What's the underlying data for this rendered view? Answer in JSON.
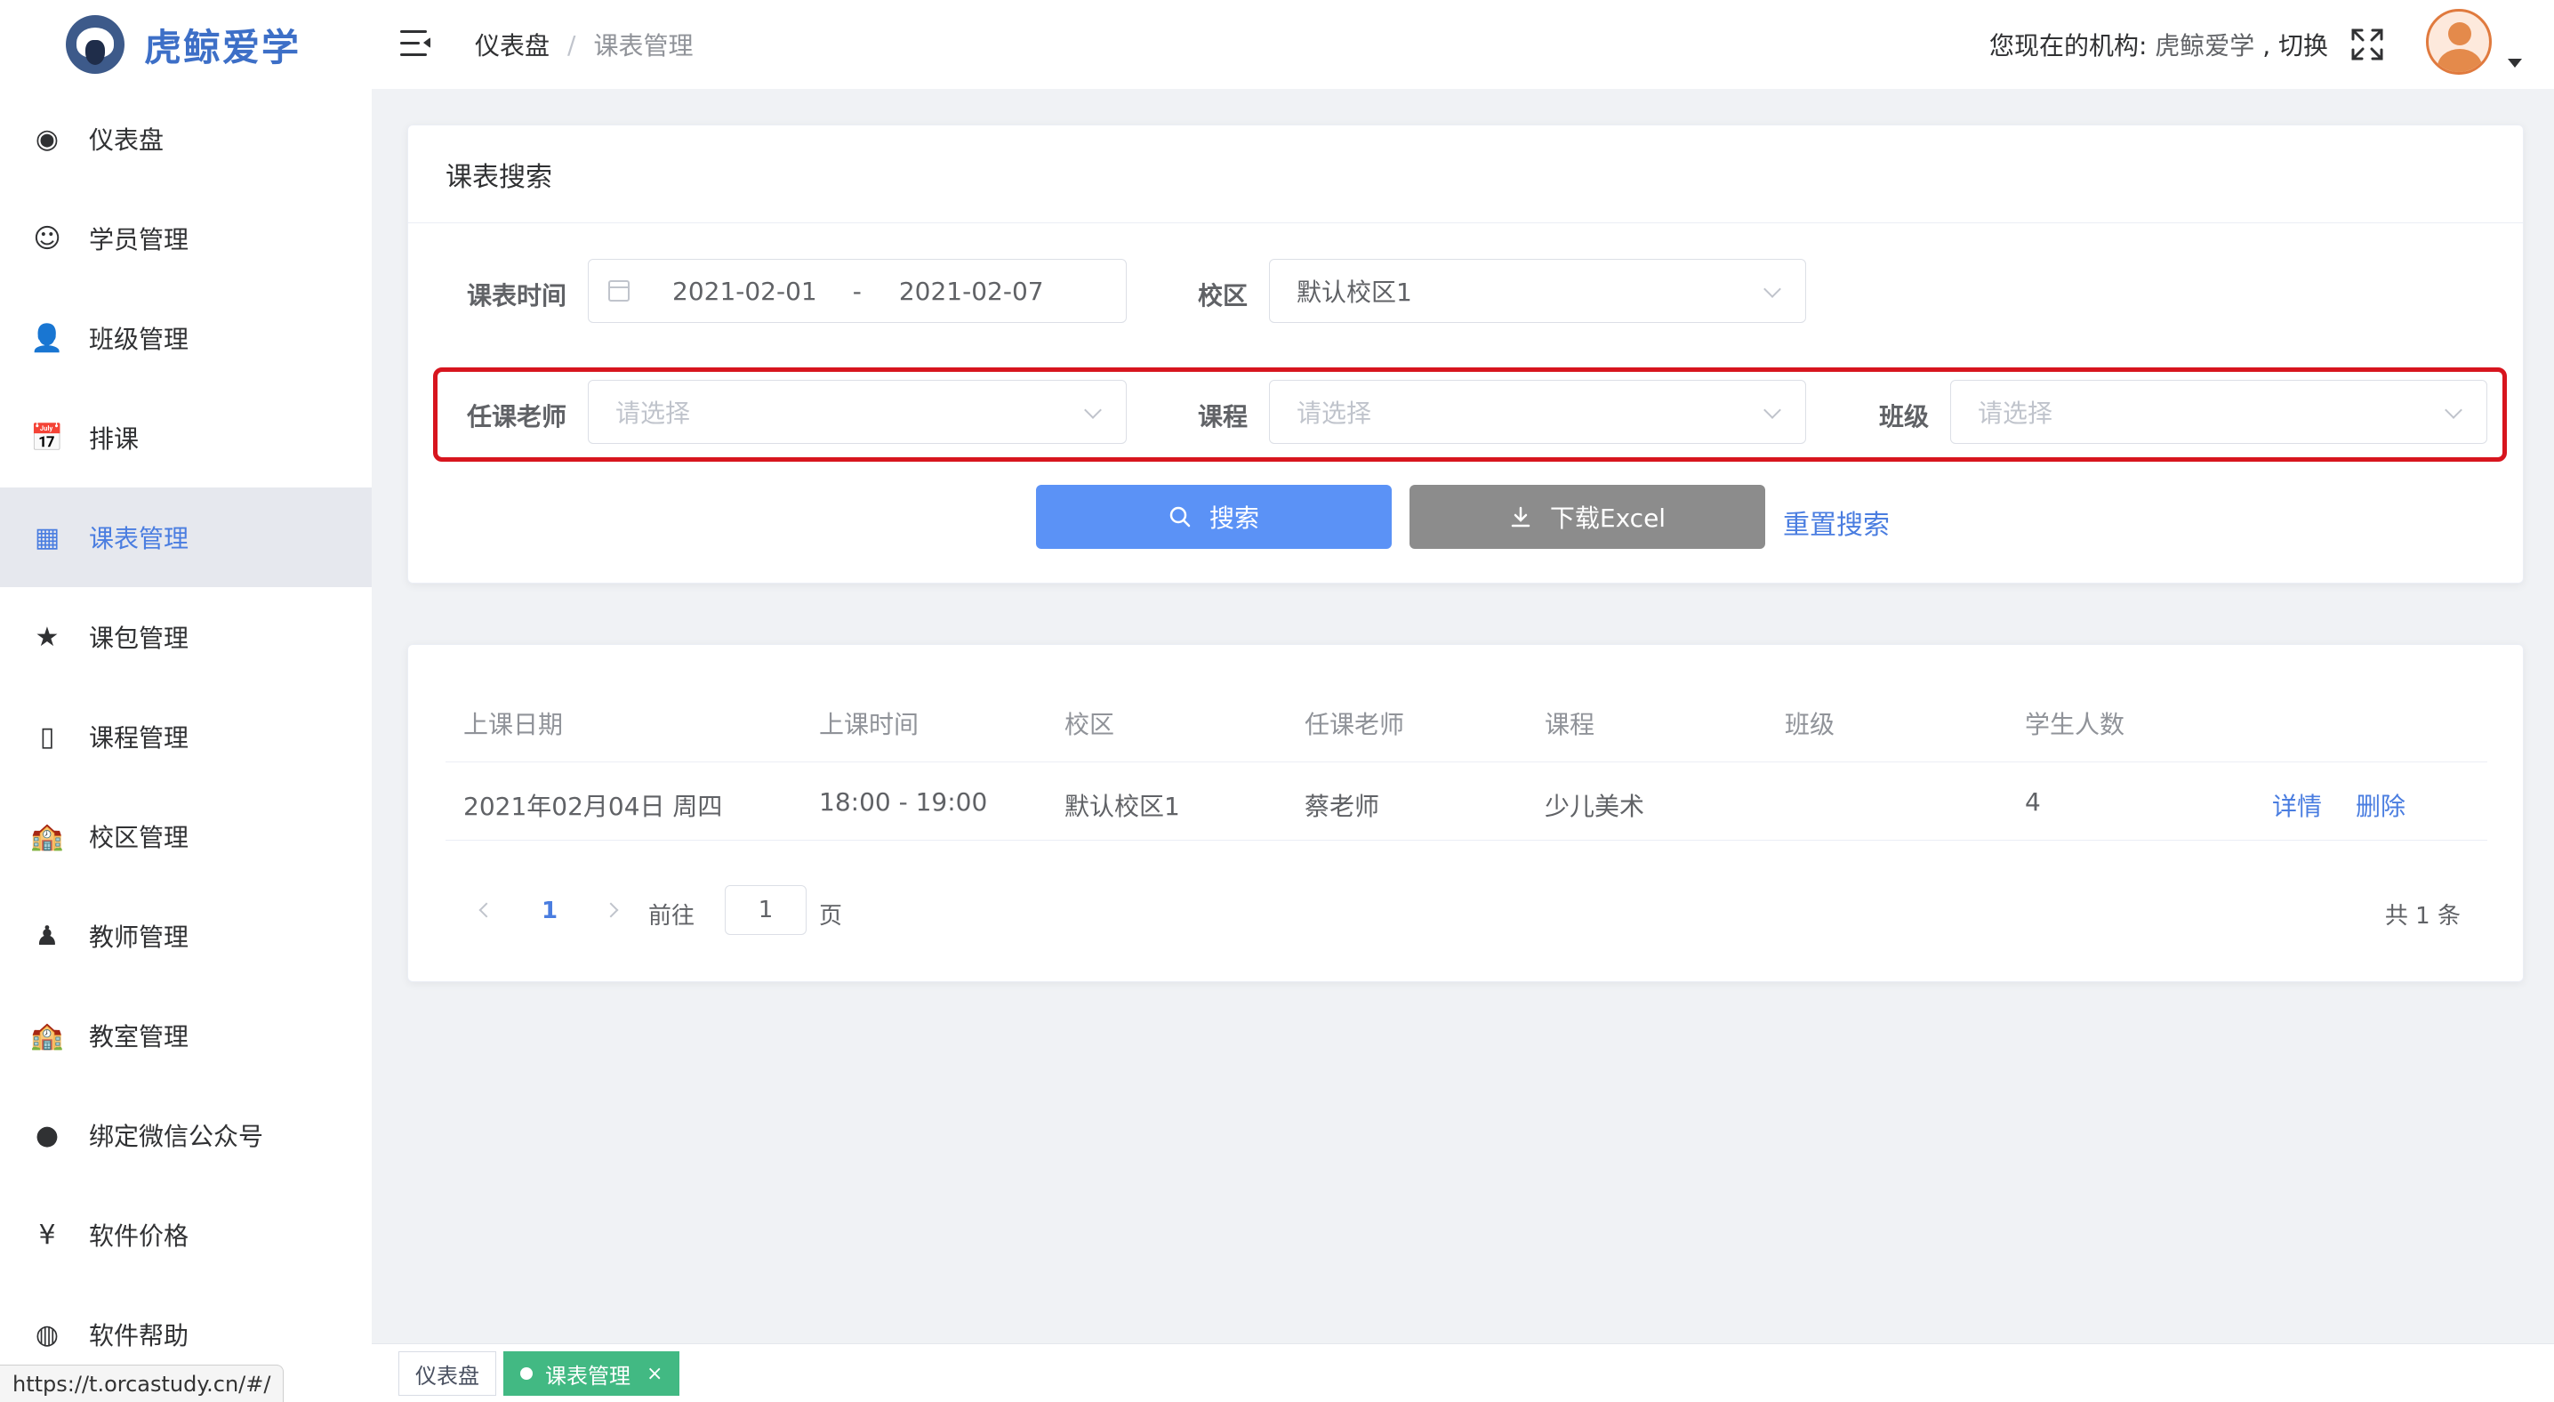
{
  "app": {
    "logo_text": "虎鲸爱学"
  },
  "sidebar": {
    "items": [
      {
        "label": "仪表盘",
        "icon": "dashboard-icon",
        "glyph": "◉"
      },
      {
        "label": "学员管理",
        "icon": "student-icon",
        "glyph": "☺"
      },
      {
        "label": "班级管理",
        "icon": "class-icon",
        "glyph": "👤"
      },
      {
        "label": "排课",
        "icon": "calendar-icon",
        "glyph": "📅"
      },
      {
        "label": "课表管理",
        "icon": "table-icon",
        "glyph": "▦"
      },
      {
        "label": "课包管理",
        "icon": "star-icon",
        "glyph": "★"
      },
      {
        "label": "课程管理",
        "icon": "book-icon",
        "glyph": "▯"
      },
      {
        "label": "校区管理",
        "icon": "school-icon",
        "glyph": "🏫"
      },
      {
        "label": "教师管理",
        "icon": "teacher-icon",
        "glyph": "♟"
      },
      {
        "label": "教室管理",
        "icon": "classroom-icon",
        "glyph": "🏫"
      },
      {
        "label": "绑定微信公众号",
        "icon": "wechat-icon",
        "glyph": "●"
      },
      {
        "label": "软件价格",
        "icon": "yen-icon",
        "glyph": "¥"
      },
      {
        "label": "软件帮助",
        "icon": "globe-icon",
        "glyph": "◍"
      }
    ],
    "active_index": 4
  },
  "status_url": "https://t.orcastudy.cn/#/",
  "header": {
    "breadcrumb_home": "仪表盘",
    "breadcrumb_sep": "/",
    "breadcrumb_current": "课表管理",
    "org_prefix": "您现在的机构: ",
    "org_name": "虎鲸爱学",
    "org_switch": " , 切换"
  },
  "search": {
    "title": "课表搜索",
    "time_label": "课表时间",
    "date_start": "2021-02-01",
    "date_sep": "-",
    "date_end": "2021-02-07",
    "campus_label": "校区",
    "campus_value": "默认校区1",
    "teacher_label": "任课老师",
    "teacher_placeholder": "请选择",
    "course_label": "课程",
    "course_placeholder": "请选择",
    "class_label": "班级",
    "class_placeholder": "请选择",
    "search_btn": "搜索",
    "excel_btn": "下载Excel",
    "reset_btn": "重置搜索"
  },
  "table": {
    "columns": [
      "上课日期",
      "上课时间",
      "校区",
      "任课老师",
      "课程",
      "班级",
      "学生人数"
    ],
    "rows": [
      {
        "date": "2021年02月04日 周四",
        "time": "18:00 - 19:00",
        "campus": "默认校区1",
        "teacher": "蔡老师",
        "course": "少儿美术",
        "class": "",
        "students": "4",
        "detail": "详情",
        "delete": "删除"
      }
    ]
  },
  "pagination": {
    "current_page": "1",
    "goto_label": "前往",
    "goto_value": "1",
    "page_unit": "页",
    "total": "共 1 条"
  },
  "tags": {
    "dashboard": "仪表盘",
    "active": "课表管理",
    "close": "×"
  },
  "colors": {
    "accent": "#4a7de0",
    "primary_button": "#5b92f6",
    "gray_button": "#8c8c8c",
    "highlight": "#d7151e",
    "active_tag": "#42b983"
  }
}
